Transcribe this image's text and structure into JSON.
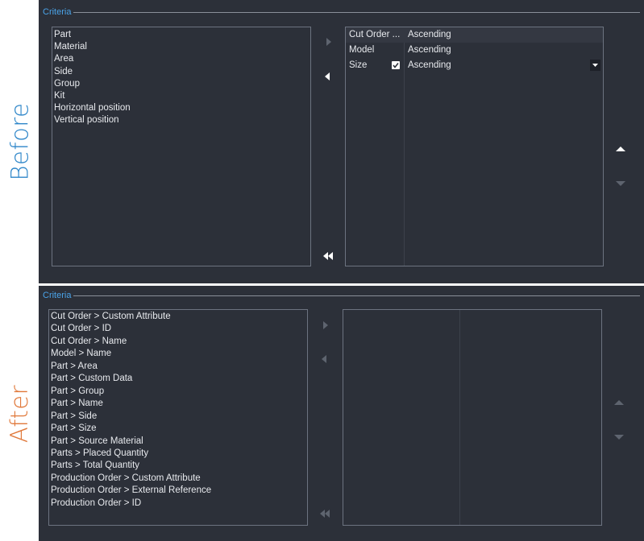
{
  "labels": {
    "before": "Before",
    "after": "After"
  },
  "colors": {
    "before_label": "#2e86c9",
    "after_label": "#e0783a",
    "panel_bg": "#2c3039",
    "legend_text": "#4aa3e8"
  },
  "before": {
    "legend": "Criteria",
    "available_items": [
      "Part",
      "Material",
      "Area",
      "Side",
      "Group",
      "Kit",
      "Horizontal position",
      "Vertical position"
    ],
    "sort_rows": [
      {
        "field": "Cut Order ...",
        "order": "Ascending",
        "checked": false
      },
      {
        "field": "Model",
        "order": "Ascending",
        "checked": false
      },
      {
        "field": "Size",
        "order": "Ascending",
        "checked": true
      }
    ]
  },
  "after": {
    "legend": "Criteria",
    "available_items": [
      "Cut Order > Custom Attribute",
      "Cut Order > ID",
      "Cut Order > Name",
      "Model > Name",
      "Part > Area",
      "Part > Custom Data",
      "Part > Group",
      "Part > Name",
      "Part > Side",
      "Part > Size",
      "Part > Source Material",
      "Parts > Placed Quantity",
      "Parts > Total Quantity",
      "Production Order > Custom Attribute",
      "Production Order > External Reference",
      "Production Order > ID"
    ]
  },
  "icons": {
    "add": "arrow-right-icon",
    "remove": "arrow-left-icon",
    "remove_all": "double-arrow-left-icon",
    "move_up": "triangle-up-icon",
    "move_down": "triangle-down-icon",
    "dropdown": "chevron-down-icon",
    "check": "check-icon"
  }
}
